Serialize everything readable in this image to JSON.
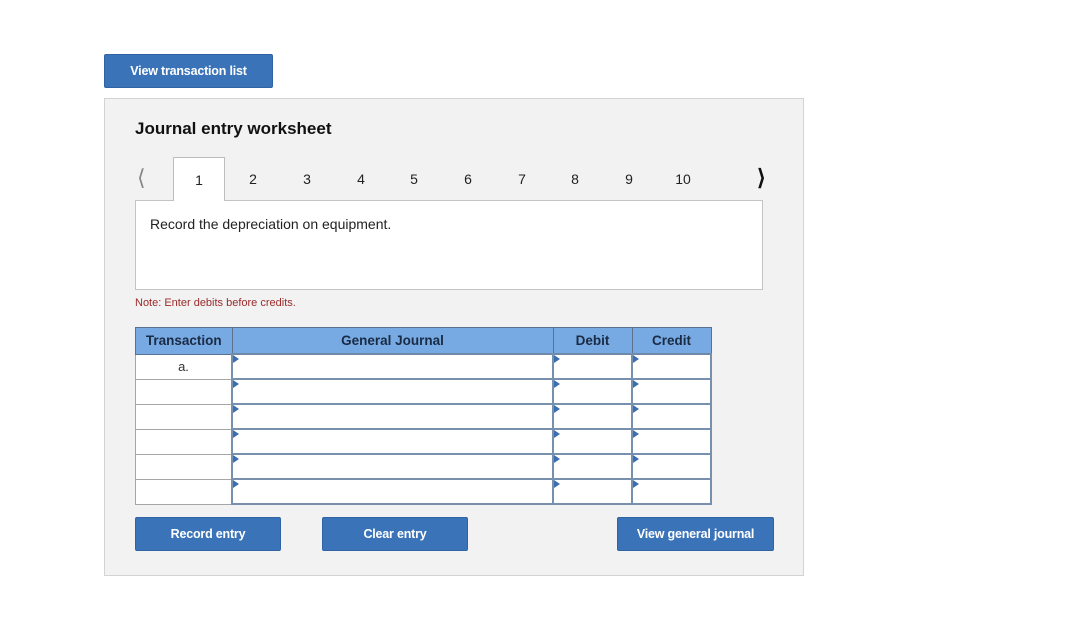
{
  "top_button": "View transaction list",
  "worksheet": {
    "title": "Journal entry worksheet",
    "tabs": [
      "1",
      "2",
      "3",
      "4",
      "5",
      "6",
      "7",
      "8",
      "9",
      "10"
    ],
    "active_tab": "1",
    "prev_icon": "chevron-left-icon",
    "next_icon": "chevron-right-icon",
    "prompt": "Record the depreciation on equipment.",
    "note": "Note: Enter debits before credits.",
    "table": {
      "headers": [
        "Transaction",
        "General Journal",
        "Debit",
        "Credit"
      ],
      "rows": [
        {
          "transaction": "a.",
          "account": "",
          "debit": "",
          "credit": ""
        },
        {
          "transaction": "",
          "account": "",
          "debit": "",
          "credit": ""
        },
        {
          "transaction": "",
          "account": "",
          "debit": "",
          "credit": ""
        },
        {
          "transaction": "",
          "account": "",
          "debit": "",
          "credit": ""
        },
        {
          "transaction": "",
          "account": "",
          "debit": "",
          "credit": ""
        },
        {
          "transaction": "",
          "account": "",
          "debit": "",
          "credit": ""
        }
      ]
    },
    "buttons": {
      "record": "Record entry",
      "clear": "Clear entry",
      "view_journal": "View general journal"
    }
  },
  "colors": {
    "button": "#3a73b8",
    "header": "#77a9e3",
    "note": "#9b2a2a"
  }
}
